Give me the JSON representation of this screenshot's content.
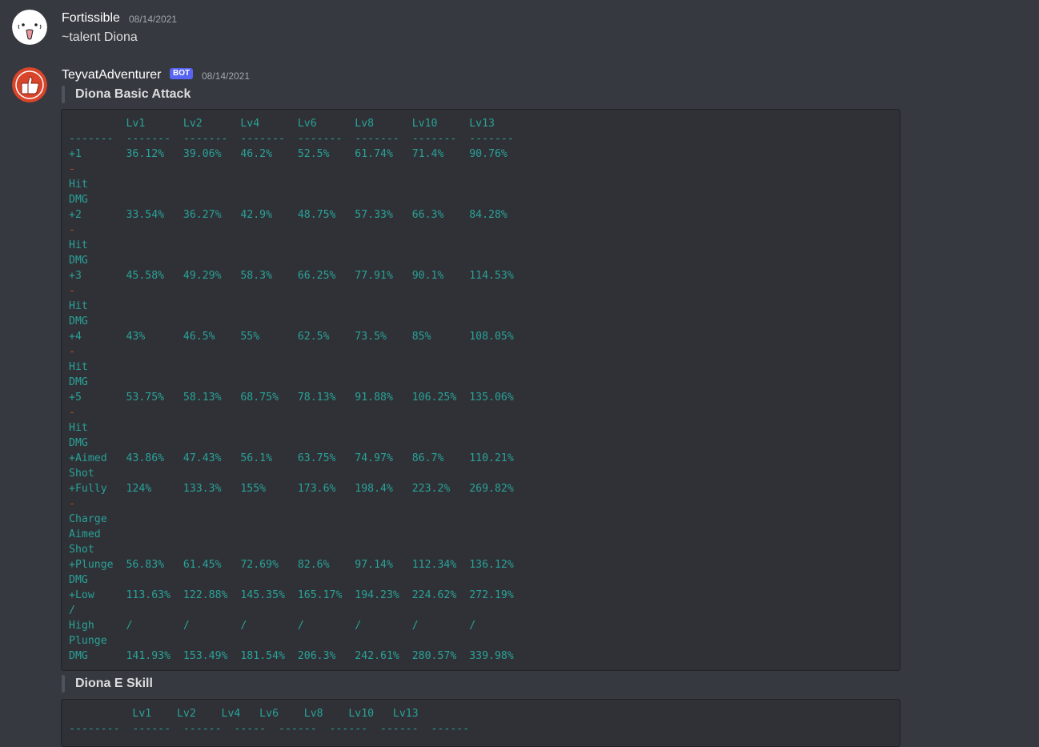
{
  "messages": [
    {
      "username": "Fortissible",
      "timestamp": "08/14/2021",
      "content": "~talent Diona"
    },
    {
      "username": "TeyvatAdventurer",
      "bot_tag": "BOT",
      "timestamp": "08/14/2021",
      "sections": [
        {
          "title": "Diona Basic Attack",
          "lines": [
            "         Lv1      Lv2      Lv4      Lv6      Lv8      Lv10     Lv13",
            "-------  -------  -------  -------  -------  -------  -------  -------",
            "+1       36.12%   39.06%   46.2%    52.5%    61.74%   71.4%    90.76%",
            "-",
            "Hit",
            "DMG",
            "+2       33.54%   36.27%   42.9%    48.75%   57.33%   66.3%    84.28%",
            "-",
            "Hit",
            "DMG",
            "+3       45.58%   49.29%   58.3%    66.25%   77.91%   90.1%    114.53%",
            "-",
            "Hit",
            "DMG",
            "+4       43%      46.5%    55%      62.5%    73.5%    85%      108.05%",
            "-",
            "Hit",
            "DMG",
            "+5       53.75%   58.13%   68.75%   78.13%   91.88%   106.25%  135.06%",
            "-",
            "Hit",
            "DMG",
            "+Aimed   43.86%   47.43%   56.1%    63.75%   74.97%   86.7%    110.21%",
            "Shot",
            "+Fully   124%     133.3%   155%     173.6%   198.4%   223.2%   269.82%",
            "-",
            "Charge",
            "Aimed",
            "Shot",
            "+Plunge  56.83%   61.45%   72.69%   82.6%    97.14%   112.34%  136.12%",
            "DMG",
            "+Low     113.63%  122.88%  145.35%  165.17%  194.23%  224.62%  272.19%",
            "/",
            "High     /        /        /        /        /        /        /",
            "Plunge",
            "DMG      141.93%  153.49%  181.54%  206.3%   242.61%  280.57%  339.98%"
          ]
        },
        {
          "title": "Diona E Skill",
          "lines": [
            "          Lv1    Lv2    Lv4   Lv6    Lv8    Lv10   Lv13",
            "--------  ------  ------  -----  ------  ------  ------  ------"
          ]
        }
      ]
    }
  ],
  "colors": {
    "background": "#36393f",
    "codeblock_bg": "#2f3136",
    "code_text": "#2aa198",
    "code_dash": "#cb4b16",
    "bot_tag": "#5865f2"
  },
  "icons": {
    "avatar1": "white-blob-face-avatar",
    "avatar2": "red-thumbs-up-avatar"
  }
}
